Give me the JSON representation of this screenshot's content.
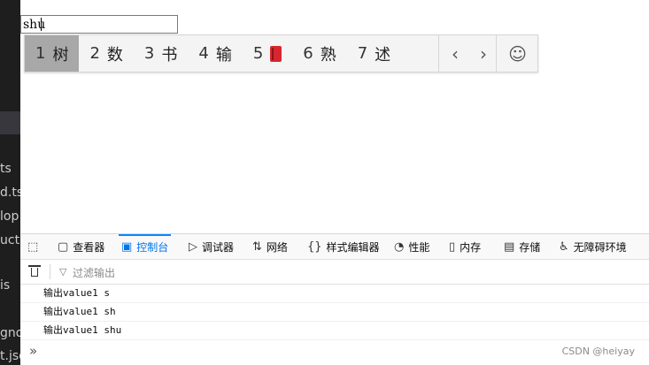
{
  "editor": {
    "fragments": [
      "ts",
      "d.ts",
      "lop",
      "ucti",
      "is",
      "gnor",
      "t.jso"
    ]
  },
  "page": {
    "input_value": "shu"
  },
  "ime": {
    "candidates": [
      {
        "num": "1",
        "text": "树"
      },
      {
        "num": "2",
        "text": "数"
      },
      {
        "num": "3",
        "text": "书"
      },
      {
        "num": "4",
        "text": "输"
      },
      {
        "num": "5",
        "text": ""
      },
      {
        "num": "6",
        "text": "熟"
      },
      {
        "num": "7",
        "text": "述"
      }
    ],
    "prev_glyph": "‹",
    "next_glyph": "›",
    "emoji_glyph": "☺"
  },
  "devtools": {
    "tabs": [
      {
        "label": "",
        "icon": "pick-element-icon",
        "glyph": "⬚"
      },
      {
        "label": "查看器",
        "icon": "inspector-icon",
        "glyph": "▢"
      },
      {
        "label": "控制台",
        "icon": "console-icon",
        "glyph": "▣"
      },
      {
        "label": "调试器",
        "icon": "debugger-icon",
        "glyph": "▷"
      },
      {
        "label": "网络",
        "icon": "network-icon",
        "glyph": "⇅"
      },
      {
        "label": "样式编辑器",
        "icon": "style-editor-icon",
        "glyph": "{}"
      },
      {
        "label": "性能",
        "icon": "performance-icon",
        "glyph": "◔"
      },
      {
        "label": "内存",
        "icon": "memory-icon",
        "glyph": "▯"
      },
      {
        "label": "存储",
        "icon": "storage-icon",
        "glyph": "▤"
      },
      {
        "label": "无障碍环境",
        "icon": "accessibility-icon",
        "glyph": "♿"
      }
    ],
    "active_tab": "控制台",
    "filter_placeholder": "过滤输出",
    "logs": [
      "输出value1 s",
      "输出value1 sh",
      "输出value1 shu"
    ],
    "prompt_glyph": "»"
  },
  "watermark": "CSDN @heiyay",
  "colors": {
    "accent": "#0074e8",
    "ime_active": "#a8a8a8",
    "editor_bg": "#1e1e1e"
  }
}
